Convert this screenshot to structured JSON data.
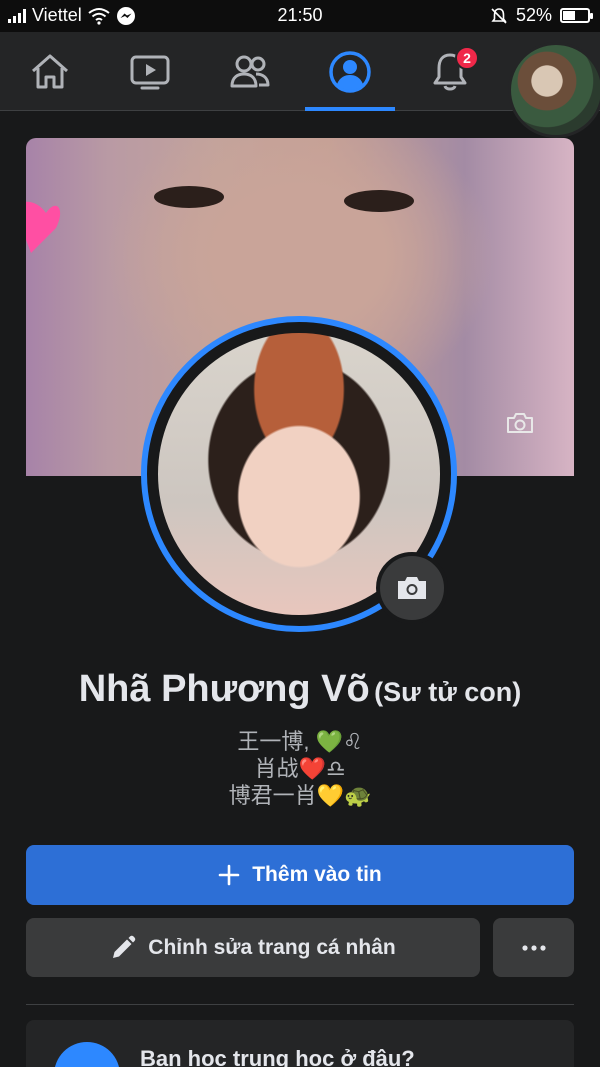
{
  "status_bar": {
    "carrier": "Viettel",
    "time": "21:50",
    "battery": "52%",
    "battery_level": 0.52
  },
  "nav": {
    "tabs": [
      {
        "icon": "home-icon"
      },
      {
        "icon": "watch-icon"
      },
      {
        "icon": "friends-icon"
      },
      {
        "icon": "profile-icon",
        "active": true
      },
      {
        "icon": "notifications-icon",
        "badge": "2"
      },
      {
        "icon": "account-avatar"
      }
    ]
  },
  "profile": {
    "name": "Nhã Phương Võ",
    "nickname": "(Sư tử con)",
    "bio_lines": [
      "王一博, 💚♌",
      "肖战❤️♎",
      "博君一肖💛🐢"
    ]
  },
  "actions": {
    "add_story": "Thêm vào tin",
    "edit_profile": "Chỉnh sửa trang cá nhân",
    "more": "•••"
  },
  "card": {
    "title": "Bạn học trung học ở đâu?"
  },
  "colors": {
    "accent": "#2d88ff",
    "primary_button": "#2d6fd6",
    "badge": "#f02849",
    "background": "#18191a"
  }
}
